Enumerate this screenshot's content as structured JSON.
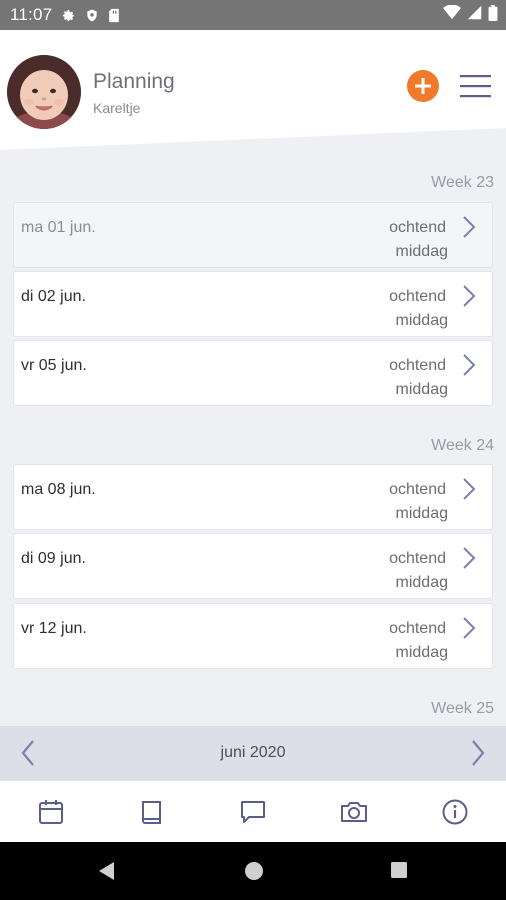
{
  "status_bar": {
    "time": "11:07"
  },
  "header": {
    "title": "Planning",
    "subtitle": "Kareltje"
  },
  "weeks": [
    {
      "label": "Week 23",
      "days": [
        {
          "date": "ma 01 jun.",
          "part1": "ochtend",
          "part2": "middag"
        },
        {
          "date": "di 02 jun.",
          "part1": "ochtend",
          "part2": "middag"
        },
        {
          "date": "vr 05 jun.",
          "part1": "ochtend",
          "part2": "middag"
        }
      ]
    },
    {
      "label": "Week 24",
      "days": [
        {
          "date": "ma 08 jun.",
          "part1": "ochtend",
          "part2": "middag"
        },
        {
          "date": "di 09 jun.",
          "part1": "ochtend",
          "part2": "middag"
        },
        {
          "date": "vr 12 jun.",
          "part1": "ochtend",
          "part2": "middag"
        }
      ]
    },
    {
      "label": "Week 25",
      "days": []
    }
  ],
  "month_nav": {
    "label": "juni 2020"
  },
  "tabs": [
    "calendar-icon",
    "book-icon",
    "chat-icon",
    "camera-icon",
    "info-icon"
  ],
  "colors": {
    "accent": "#f07a2a",
    "icon": "#5c5e8a",
    "chevron": "#7d80a8"
  }
}
